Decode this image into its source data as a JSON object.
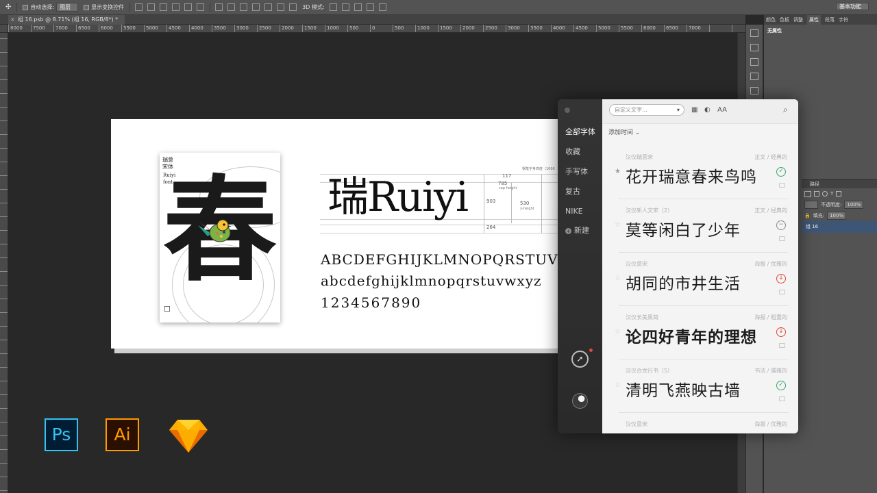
{
  "options_bar": {
    "auto_select_label": "自动选择:",
    "auto_select_value": "图层",
    "show_transform_label": "显示变换控件",
    "mode_3d_label": "3D 模式:",
    "workspace_value": "基本功能"
  },
  "document": {
    "tab_title": "组 16.psb @ 8.71% (组 16, RGB/8*) *",
    "ruler_labels": [
      "8000",
      "7500",
      "7000",
      "6500",
      "6000",
      "5500",
      "5000",
      "4500",
      "4000",
      "3500",
      "3000",
      "2500",
      "2000",
      "1500",
      "1000",
      "500",
      "0",
      "500",
      "1000",
      "1500",
      "2000",
      "2500",
      "3000",
      "3500",
      "4000",
      "4500",
      "5000",
      "5500",
      "6000",
      "6500",
      "7000"
    ]
  },
  "right_panel": {
    "tabs": [
      "颜色",
      "色板",
      "调整",
      "属性",
      "段落",
      "字符"
    ],
    "active_tab": "属性",
    "title": "无属性",
    "layers_tab": "路径",
    "opacity_label": "不透明度:",
    "opacity_value": "100%",
    "fill_label": "填充:",
    "fill_value": "100%",
    "layer_name": "组 16"
  },
  "artboard": {
    "poster_title": "瑞意宋体",
    "poster_sub": "Ruiyi font",
    "poster_char": "春",
    "hero_text": "瑞Ruiyi",
    "metrics_caption": "钢笔字身高度（1000",
    "metrics": [
      "117",
      "785",
      "903",
      "530",
      "264"
    ],
    "metrics_notes": [
      "cap height",
      "x-height"
    ],
    "uppercase": "ABCDEFGHIJKLMNOPQRSTUVWXY",
    "lowercase": "abcdefghijklmnopqrstuvwxyz",
    "digits": "1234567890"
  },
  "fontapp": {
    "nav": [
      "全部字体",
      "收藏",
      "手写体",
      "复古",
      "NIKE",
      "新建"
    ],
    "active_nav": "全部字体",
    "search_placeholder": "自定义文字...",
    "sort_label": "添加时间 ⌄",
    "icons": [
      "grid-icon",
      "contrast-icon",
      "font-size-icon",
      "search-icon",
      "compass-icon",
      "avatar"
    ],
    "fonts": [
      {
        "name": "汉仪瑞意宋",
        "category": "正文 / 经典的",
        "sample": "花开瑞意春来鸟鸣",
        "status": "installed",
        "starred": true
      },
      {
        "name": "汉仪新人文宋（2）",
        "category": "正文 / 经典的",
        "sample": "莫等闲白了少年",
        "status": "partial",
        "starred": false
      },
      {
        "name": "汉仪意宋",
        "category": "海报 / 优雅的",
        "sample": "胡同的市井生活",
        "status": "download",
        "starred": false
      },
      {
        "name": "汉仪长美黑简",
        "category": "海报 / 粗重的",
        "sample": "论四好青年的理想",
        "status": "download",
        "starred": false
      },
      {
        "name": "汉仪合龙行书（5）",
        "category": "书法 / 儒雅的",
        "sample": "清明飞燕映古墙",
        "status": "installed",
        "starred": false
      },
      {
        "name": "汉仪意宋",
        "category": "海报 / 优雅的",
        "sample": "",
        "status": "",
        "starred": false
      }
    ],
    "status_colors": {
      "installed": "#3aa66a",
      "partial": "#8a8a8a",
      "download": "#e0483e"
    }
  },
  "dock": {
    "ps_label": "Ps",
    "ai_label": "Ai"
  }
}
